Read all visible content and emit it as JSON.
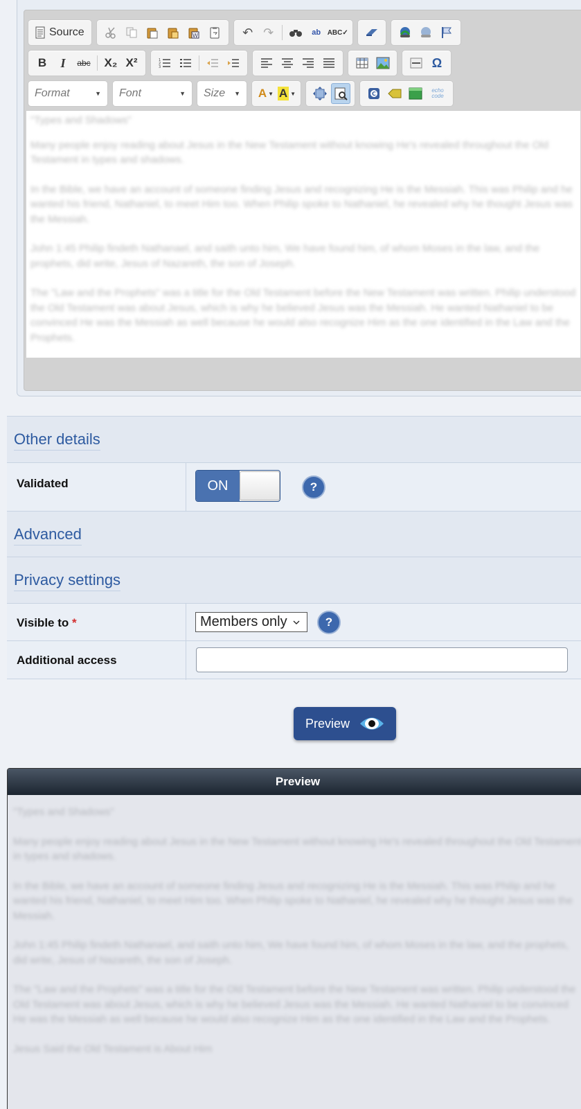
{
  "editor": {
    "toolbar": {
      "source_label": "Source",
      "format_placeholder": "Format",
      "font_placeholder": "Font",
      "size_placeholder": "Size",
      "bold_label": "B",
      "italic_label": "I",
      "strike_label": "abc",
      "subscript_label": "X₂",
      "superscript_label": "X²",
      "code_label": "echo code"
    },
    "content": [
      "\"Types and Shadows\"",
      "Many people enjoy reading about Jesus in the New Testament without knowing He's revealed throughout the Old Testament in types and shadows.",
      "In the Bible, we have an account of someone finding Jesus and recognizing He is the Messiah. This was Philip and he wanted his friend, Nathaniel, to meet Him too. When Philip spoke to Nathaniel, he revealed why he thought Jesus was the Messiah.",
      "John 1:45 Philip findeth Nathanael, and saith unto him, We have found him, of whom Moses in the law, and the prophets, did write, Jesus of Nazareth, the son of Joseph.",
      "The \"Law and the Prophets\" was a title for the Old Testament before the New Testament was written. Philip understood the Old Testament was about Jesus, which is why he believed Jesus was the Messiah. He wanted Nathaniel to be convinced He was the Messiah as well because he would also recognize Him as the one identified in the Law and the Prophets."
    ]
  },
  "sections": {
    "other_details": "Other details",
    "advanced": "Advanced",
    "privacy": "Privacy settings"
  },
  "fields": {
    "validated_label": "Validated",
    "validated_state": "ON",
    "visible_to_label": "Visible to",
    "required_mark": "*",
    "visible_to_value": "Members only",
    "additional_access_label": "Additional access",
    "additional_access_value": "",
    "help_glyph": "?"
  },
  "preview_button": {
    "label": "Preview"
  },
  "preview_panel": {
    "title": "Preview",
    "content": [
      "\"Types and Shadows\"",
      "Many people enjoy reading about Jesus in the New Testament without knowing He's revealed throughout the Old Testament in types and shadows.",
      "In the Bible, we have an account of someone finding Jesus and recognizing He is the Messiah. This was Philip and he wanted his friend, Nathaniel, to meet Him too. When Philip spoke to Nathaniel, he revealed why he thought Jesus was the Messiah.",
      "John 1:45 Philip findeth Nathanael, and saith unto him, We have found him, of whom Moses in the law, and the prophets, did write, Jesus of Nazareth, the son of Joseph.",
      "The \"Law and the Prophets\" was a title for the Old Testament before the New Testament was written. Philip understood the Old Testament was about Jesus, which is why he believed Jesus was the Messiah. He wanted Nathaniel to be convinced He was the Messiah as well because he would also recognize Him as the one identified in the Law and the Prophets.",
      "Jesus Said the Old Testament is About Him"
    ]
  },
  "colors": {
    "accent": "#2d5aa0",
    "button": "#2d4f8f",
    "toggle_on": "#4a72b0"
  }
}
